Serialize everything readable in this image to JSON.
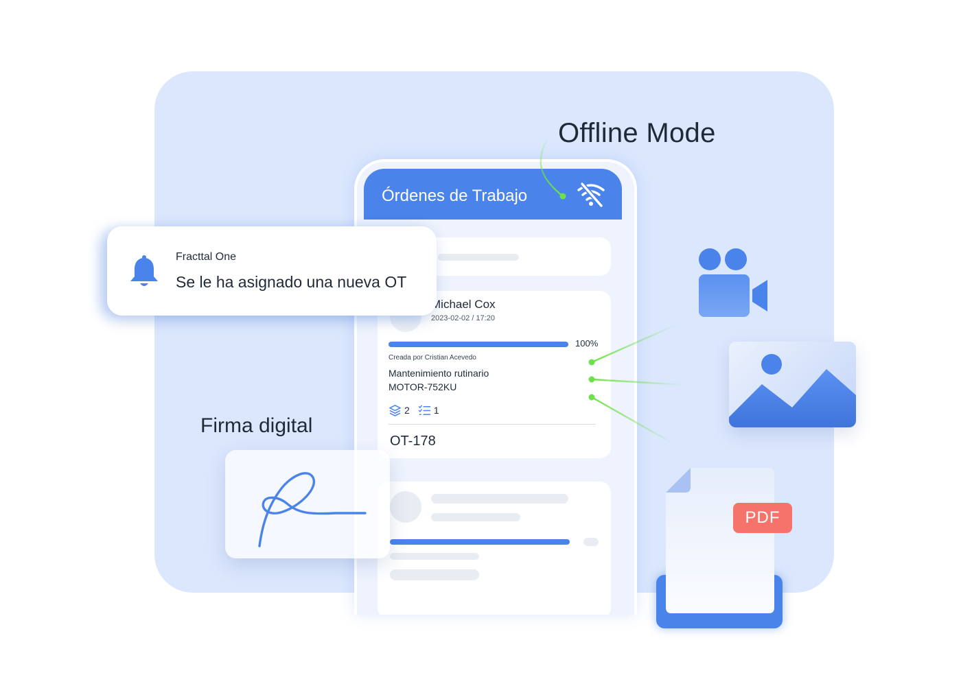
{
  "offline_label": "Offline Mode",
  "signature_label": "Firma digital",
  "phone": {
    "title": "Órdenes de Trabajo",
    "work_order": {
      "assignee": "Michael Cox",
      "datetime": "2023-02-02 / 17:20",
      "progress": 100,
      "progress_label": "100%",
      "created_by": "Creada por Cristian Acevedo",
      "task": "Mantenimiento rutinario",
      "asset": "MOTOR-752KU",
      "layers_count": "2",
      "checklist_count": "1",
      "id": "OT-178"
    }
  },
  "notification": {
    "app": "Fracttal One",
    "message": "Se le ha asignado una nueva OT"
  },
  "pdf_badge": "PDF",
  "icons": [
    "wifi-off-icon",
    "bell-icon",
    "layers-icon",
    "checklist-icon",
    "video-camera-icon",
    "image-icon",
    "document-icon"
  ],
  "colors": {
    "accent": "#4a84ea",
    "background_panel": "#dbe7fd",
    "connector": "#6ee04a",
    "pdf_badge": "#f5736b"
  }
}
